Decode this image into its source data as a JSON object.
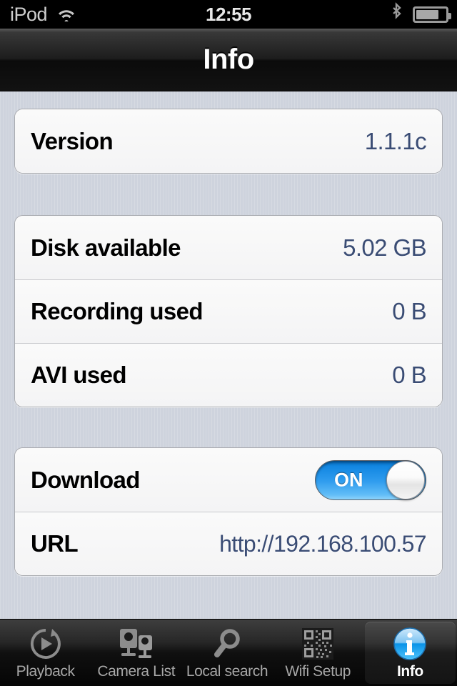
{
  "status_bar": {
    "carrier": "iPod",
    "wifi_icon": "wifi-icon",
    "time": "12:55",
    "bluetooth_icon": "bluetooth-icon",
    "battery_icon": "battery-icon",
    "battery_level_percent": 78
  },
  "nav_bar": {
    "title": "Info"
  },
  "groups": [
    {
      "rows": [
        {
          "label": "Version",
          "value": "1.1.1c",
          "type": "value"
        }
      ]
    },
    {
      "rows": [
        {
          "label": "Disk available",
          "value": "5.02 GB",
          "type": "value"
        },
        {
          "label": "Recording used",
          "value": "0 B",
          "type": "value"
        },
        {
          "label": "AVI used",
          "value": "0 B",
          "type": "value"
        }
      ]
    },
    {
      "rows": [
        {
          "label": "Download",
          "value": "ON",
          "type": "switch",
          "switch_on": true
        },
        {
          "label": "URL",
          "value": "http://192.168.100.57",
          "type": "url"
        }
      ]
    }
  ],
  "tab_bar": {
    "tabs": [
      {
        "label": "Playback",
        "icon": "playback-icon",
        "selected": false
      },
      {
        "label": "Camera List",
        "icon": "camera-list-icon",
        "selected": false
      },
      {
        "label": "Local search",
        "icon": "magnifier-icon",
        "selected": false
      },
      {
        "label": "Wifi Setup",
        "icon": "qr-code-icon",
        "selected": false
      },
      {
        "label": "Info",
        "icon": "info-circle-icon",
        "selected": true
      }
    ]
  },
  "colors": {
    "background": "#ced3dd",
    "cell_background": "#f7f7f7",
    "value_text": "#3a4c74",
    "label_text": "#000000",
    "switch_on_accent": "#1287e2",
    "navbar_dark": "#121212",
    "tabbar_dark": "#050505",
    "info_icon_blue": "#2aa3e8"
  }
}
